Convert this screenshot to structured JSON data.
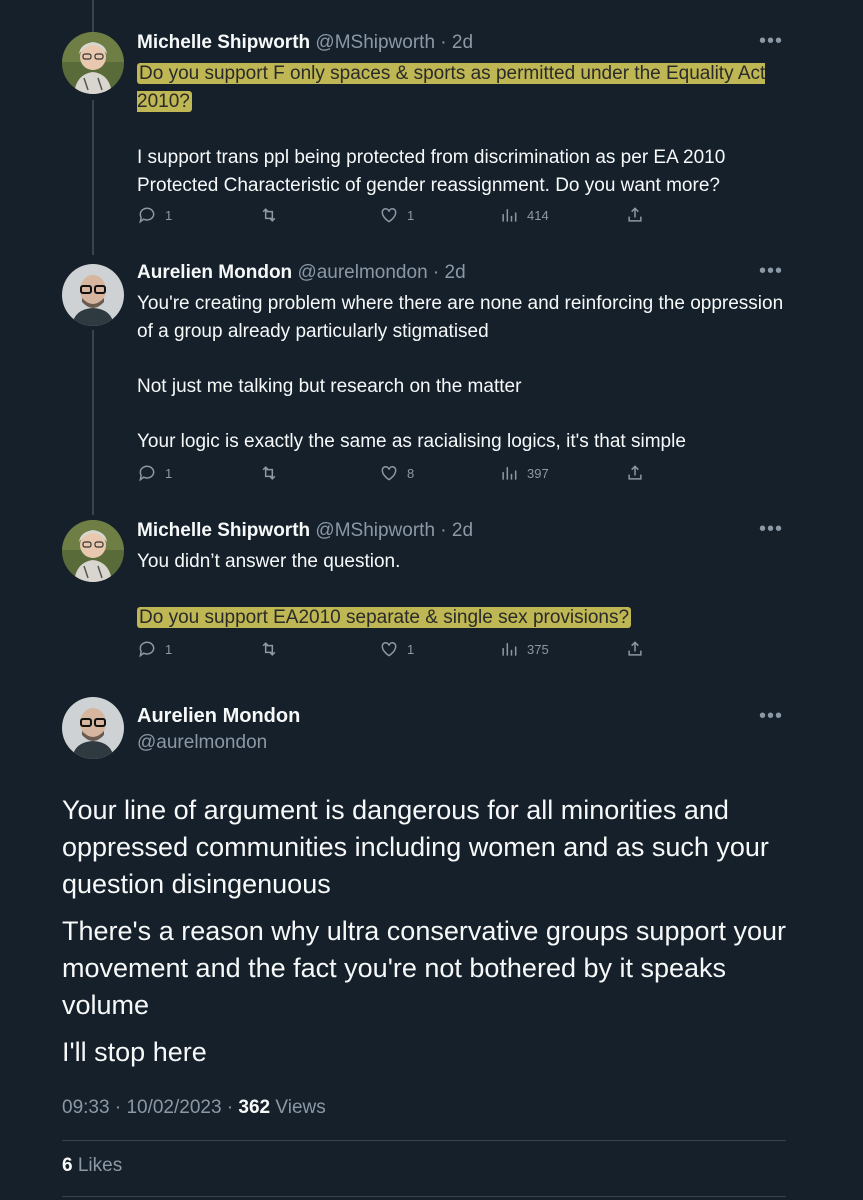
{
  "tweets": [
    {
      "name": "Michelle Shipworth",
      "handle": "@MShipworth",
      "time": "2d",
      "text_highlighted": "Do you support F only spaces & sports as permitted under the Equality Act 2010?",
      "text": "I support trans ppl being protected from discrimination as per EA 2010 Protected Characteristic of gender reassignment. Do you want more?",
      "replies": "1",
      "likes": "1",
      "views": "414"
    },
    {
      "name": "Aurelien Mondon",
      "handle": "@aurelmondon",
      "time": "2d",
      "paragraphs": [
        "You're creating problem where there are none and reinforcing the oppression of a group already particularly stigmatised",
        "Not just me talking but research on the matter",
        "Your logic is exactly the same as racialising logics, it's that simple"
      ],
      "replies": "1",
      "likes": "8",
      "views": "397"
    },
    {
      "name": "Michelle Shipworth",
      "handle": "@MShipworth",
      "time": "2d",
      "text": "You didn’t answer the question.",
      "text_highlighted": "Do you support EA2010 separate & single sex provisions?",
      "replies": "1",
      "likes": "1",
      "views": "375"
    }
  ],
  "main_tweet": {
    "name": "Aurelien Mondon",
    "handle": "@aurelmondon",
    "paragraphs": [
      "Your line of argument is dangerous for all minorities and oppressed communities including women and as such your question disingenuous",
      "There's a reason why ultra conservative groups support your movement and the fact you're not bothered by it speaks volume",
      "I'll stop here"
    ],
    "time": "09:33",
    "date": "10/02/2023",
    "views_count": "362",
    "views_label": "Views",
    "likes_count": "6",
    "likes_label": "Likes"
  },
  "separators": {
    "dot": "·"
  },
  "more_icon": "more-icon",
  "colors": {
    "background": "#15202b",
    "secondary_text": "#8b98a5",
    "highlight": "#d6cc5a"
  }
}
